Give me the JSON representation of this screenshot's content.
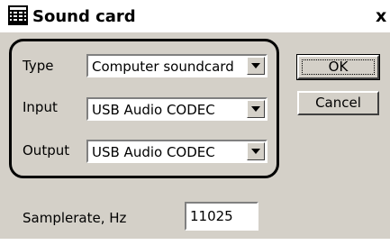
{
  "window": {
    "title": "Sound card",
    "close_glyph": "x",
    "icon": "sound-card-icon"
  },
  "devices": {
    "type": {
      "label": "Type",
      "value": "Computer soundcard"
    },
    "input": {
      "label": "Input",
      "value": "USB Audio CODEC"
    },
    "output": {
      "label": "Output",
      "value": "USB Audio CODEC"
    }
  },
  "buttons": {
    "ok": "OK",
    "cancel": "Cancel"
  },
  "samplerate": {
    "label": "Samplerate, Hz",
    "value": "11025"
  }
}
